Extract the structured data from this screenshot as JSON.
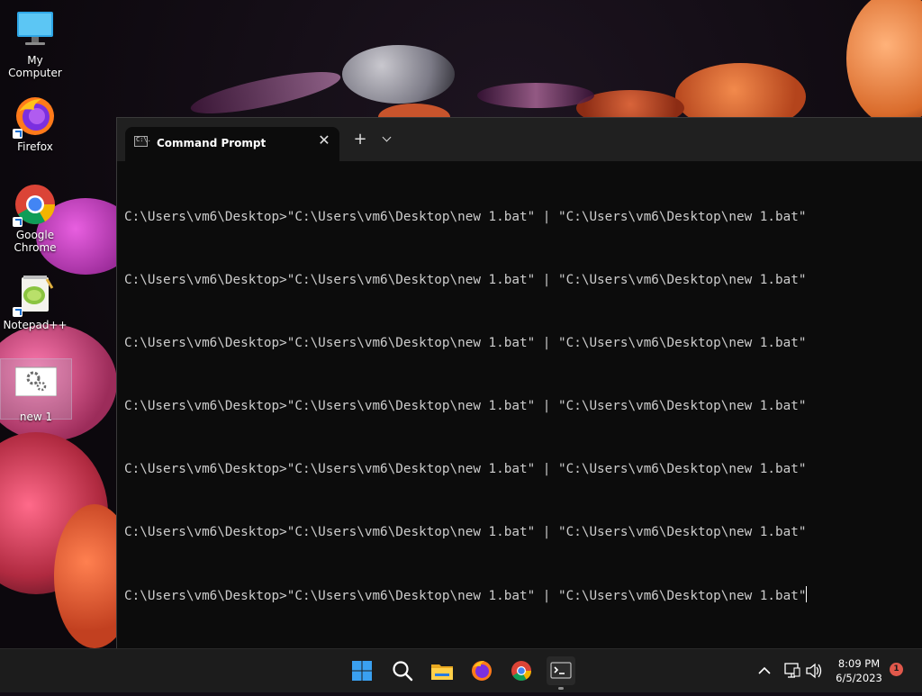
{
  "desktop": {
    "icons": [
      {
        "label": "My Computer",
        "icon": "monitor-icon"
      },
      {
        "label": "Firefox",
        "icon": "firefox-icon"
      },
      {
        "label": "Google Chrome",
        "icon": "chrome-icon"
      },
      {
        "label": "Notepad++",
        "icon": "notepadpp-icon"
      },
      {
        "label": "new 1",
        "icon": "batch-file-icon"
      }
    ]
  },
  "terminal": {
    "tab_title": "Command Prompt",
    "tab_icon_text": "C:\\.",
    "new_tab_label": "+",
    "close_label": "✕",
    "lines": [
      "C:\\Users\\vm6\\Desktop>\"C:\\Users\\vm6\\Desktop\\new 1.bat\" | \"C:\\Users\\vm6\\Desktop\\new 1.bat\"",
      "C:\\Users\\vm6\\Desktop>\"C:\\Users\\vm6\\Desktop\\new 1.bat\" | \"C:\\Users\\vm6\\Desktop\\new 1.bat\"",
      "C:\\Users\\vm6\\Desktop>\"C:\\Users\\vm6\\Desktop\\new 1.bat\" | \"C:\\Users\\vm6\\Desktop\\new 1.bat\"",
      "C:\\Users\\vm6\\Desktop>\"C:\\Users\\vm6\\Desktop\\new 1.bat\" | \"C:\\Users\\vm6\\Desktop\\new 1.bat\"",
      "C:\\Users\\vm6\\Desktop>\"C:\\Users\\vm6\\Desktop\\new 1.bat\" | \"C:\\Users\\vm6\\Desktop\\new 1.bat\"",
      "C:\\Users\\vm6\\Desktop>\"C:\\Users\\vm6\\Desktop\\new 1.bat\" | \"C:\\Users\\vm6\\Desktop\\new 1.bat\"",
      "C:\\Users\\vm6\\Desktop>\"C:\\Users\\vm6\\Desktop\\new 1.bat\" | \"C:\\Users\\vm6\\Desktop\\new 1.bat\""
    ]
  },
  "taskbar": {
    "apps": [
      "start-icon",
      "search-icon",
      "file-explorer-icon",
      "firefox-icon",
      "chrome-icon",
      "terminal-icon"
    ],
    "tray_icons": [
      "chevron-up-icon",
      "network-icon",
      "volume-icon"
    ],
    "time": "8:09 PM",
    "date": "6/5/2023",
    "notification_count": "1"
  },
  "colors": {
    "terminal_bg": "#0c0c0c",
    "titlebar_bg": "#202020",
    "taskbar_bg": "#1c1c1c",
    "console_text": "#cccccc",
    "notification_badge": "#e0584b"
  }
}
